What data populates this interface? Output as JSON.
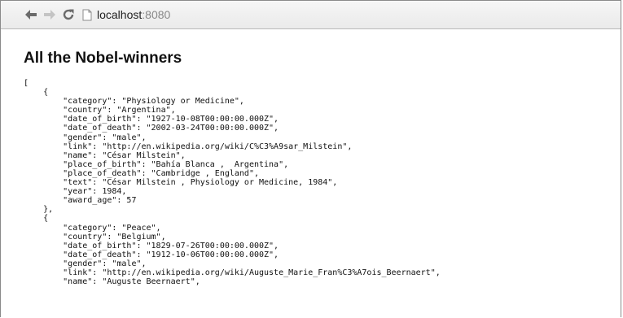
{
  "browser": {
    "url_host": "localhost",
    "url_port": ":8080"
  },
  "page": {
    "title": "All the Nobel-winners",
    "json_lines": [
      "[",
      "    {",
      "        \"category\": \"Physiology or Medicine\",",
      "        \"country\": \"Argentina\",",
      "        \"date_of_birth\": \"1927-10-08T00:00:00.000Z\",",
      "        \"date_of_death\": \"2002-03-24T00:00:00.000Z\",",
      "        \"gender\": \"male\",",
      "        \"link\": \"http://en.wikipedia.org/wiki/C%C3%A9sar_Milstein\",",
      "        \"name\": \"César Milstein\",",
      "        \"place_of_birth\": \"Bahía Blanca ,  Argentina\",",
      "        \"place_of_death\": \"Cambridge , England\",",
      "        \"text\": \"César Milstein , Physiology or Medicine, 1984\",",
      "        \"year\": 1984,",
      "        \"award_age\": 57",
      "    },",
      "    {",
      "        \"category\": \"Peace\",",
      "        \"country\": \"Belgium\",",
      "        \"date_of_birth\": \"1829-07-26T00:00:00.000Z\",",
      "        \"date_of_death\": \"1912-10-06T00:00:00.000Z\",",
      "        \"gender\": \"male\",",
      "        \"link\": \"http://en.wikipedia.org/wiki/Auguste_Marie_Fran%C3%A7ois_Beernaert\",",
      "        \"name\": \"Auguste Beernaert\","
    ]
  }
}
